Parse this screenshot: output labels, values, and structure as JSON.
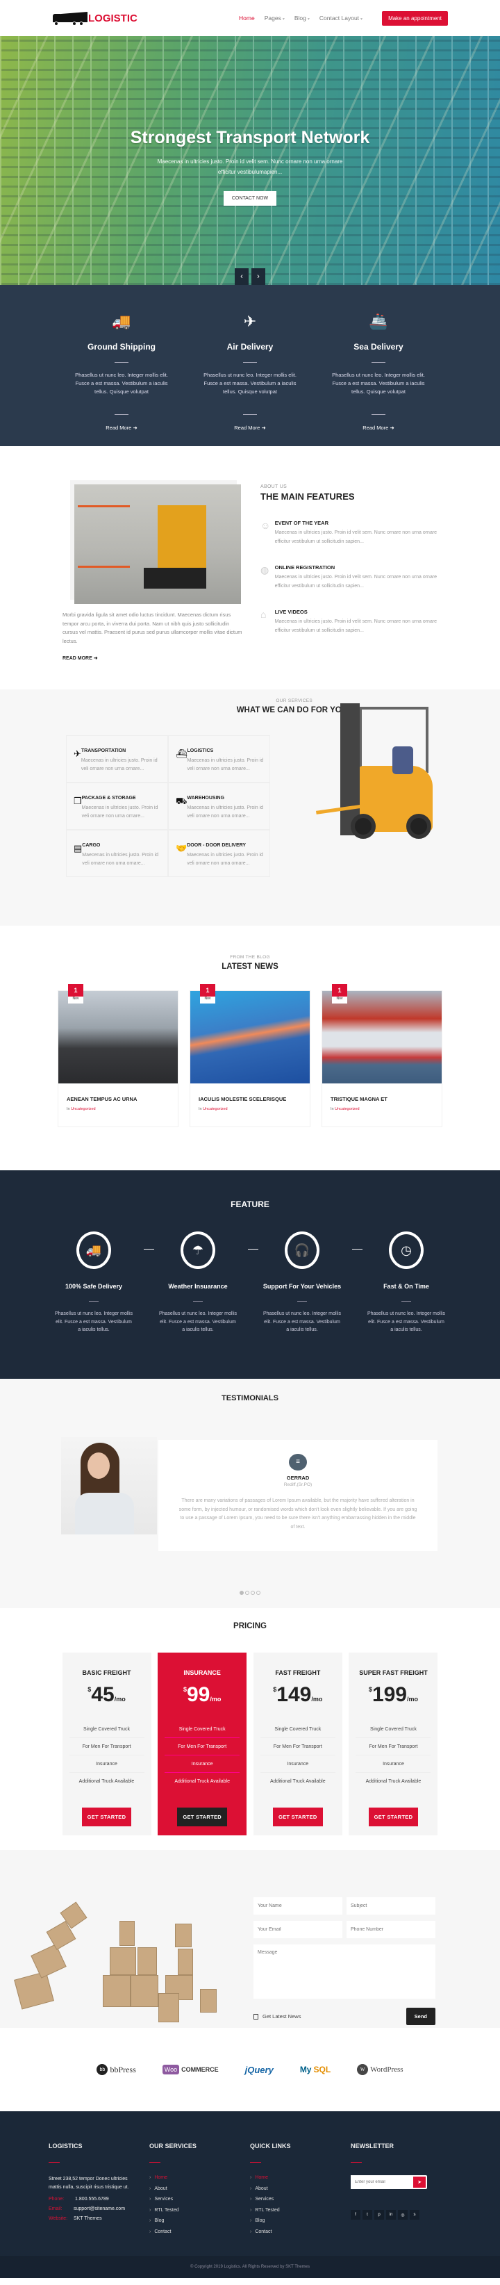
{
  "header": {
    "logo_text": "LOGISTIC",
    "nav": [
      {
        "label": "Home",
        "active": true,
        "dropdown": false
      },
      {
        "label": "Pages",
        "active": false,
        "dropdown": true
      },
      {
        "label": "Blog",
        "active": false,
        "dropdown": true
      },
      {
        "label": "Contact Layout",
        "active": false,
        "dropdown": true
      }
    ],
    "appointment_label": "Make an appointment"
  },
  "hero": {
    "title": "Strongest Transport Network",
    "subtitle": "Maecenas in ultricies justo. Proin id velit sem. Nunc ornare non urna ornare efficitur vestibulumapien...",
    "button_label": "CONTACT NOW",
    "prev_icon": "‹",
    "next_icon": "›"
  },
  "delivery": [
    {
      "icon": "truck-icon",
      "glyph": "🚚",
      "title": "Ground Shipping",
      "text": "Phasellus ut nunc leo. Integer mollis elit. Fusce a est massa. Vestibulum a iaculis tellus. Quisque volutpat",
      "link": "Read More"
    },
    {
      "icon": "plane-icon",
      "glyph": "✈",
      "title": "Air Delivery",
      "text": "Phasellus ut nunc leo. Integer mollis elit. Fusce a est massa. Vestibulum a iaculis tellus. Quisque volutpat",
      "link": "Read More"
    },
    {
      "icon": "ship-icon",
      "glyph": "🚢",
      "title": "Sea Delivery",
      "text": "Phasellus ut nunc leo. Integer mollis elit. Fusce a est massa. Vestibulum a iaculis tellus. Quisque volutpat",
      "link": "Read More"
    }
  ],
  "about": {
    "eyebrow": "ABOUT US",
    "title": "THE MAIN FEATURES",
    "text": "Morbi gravida ligula sit amet odio luctus tincidunt. Maecenas dictum risus tempor arcu porta, in viverra dui porta. Nam ut nibh quis justo sollicitudin cursus vel mattis. Praesent id purus sed purus ullamcorper mollis vitae dictum lectus.",
    "read_more": "READ MORE",
    "features": [
      {
        "icon": "worker-icon",
        "title": "EVENT OF THE YEAR",
        "text": "Maecenas in ultricies justo. Proin id velit sem. Nunc ornare non urna ornare efficitur vestibulum ut sollicitudin sapien..."
      },
      {
        "icon": "globe-icon",
        "title": "ONLINE REGISTRATION",
        "text": "Maecenas in ultricies justo. Proin id velit sem. Nunc ornare non urna ornare efficitur vestibulum ut sollicitudin sapien..."
      },
      {
        "icon": "warehouse-icon",
        "title": "LIVE VIDEOS",
        "text": "Maecenas in ultricies justo. Proin id velit sem. Nunc ornare non urna ornare efficitur vestibulum ut sollicitudin sapien..."
      }
    ]
  },
  "services": {
    "eyebrow": "OUR SERVICES",
    "title": "WHAT WE CAN DO FOR YOU",
    "items": [
      {
        "icon": "plane-icon",
        "glyph": "✈",
        "title": "TRANSPORTATION",
        "text": "Maecenas in ultricies justo. Proin id veli ornare non urna ornare..."
      },
      {
        "icon": "ship-icon",
        "glyph": "⛴",
        "title": "LOGISTICS",
        "text": "Maecenas in ultricies justo. Proin id veli ornare non urna ornare..."
      },
      {
        "icon": "boxes-icon",
        "glyph": "❒",
        "title": "PACKAGE & STORAGE",
        "text": "Maecenas in ultricies justo. Proin id veli ornare non urna ornare..."
      },
      {
        "icon": "cart-icon",
        "glyph": "⛟",
        "title": "WAREHOUSING",
        "text": "Maecenas in ultricies justo. Proin id veli ornare non urna ornare..."
      },
      {
        "icon": "box-icon",
        "glyph": "▤",
        "title": "CARGO",
        "text": "Maecenas in ultricies justo. Proin id veli ornare non urna ornare..."
      },
      {
        "icon": "handshake-icon",
        "glyph": "🤝",
        "title": "DOOR - DOOR DELIVERY",
        "text": "Maecenas in ultricies justo. Proin id veli ornare non urna ornare..."
      }
    ]
  },
  "news": {
    "eyebrow": "FROM THE BLOG",
    "title": "LATEST NEWS",
    "posts": [
      {
        "day": "1",
        "month": "Nov",
        "title": "AENEAN TEMPUS AC URNA",
        "cat_prefix": "In",
        "category": "Uncategorized",
        "img_bg": "linear-gradient(180deg,#c5ccd4 0%,#9aa3ab 40%,#3a3b3e 62%,#2a2b2e 100%)"
      },
      {
        "day": "1",
        "month": "Nov",
        "title": "IACULIS MOLESTIE SCELERISQUE",
        "cat_prefix": "In",
        "category": "Uncategorized",
        "img_bg": "linear-gradient(170deg,#2fa4df 0%,#3b7fc8 40%,#f08a5a 48%,#3068b5 58%,#1d4fa0 100%)"
      },
      {
        "day": "1",
        "month": "Nov",
        "title": "TRISTIQUE MAGNA ET",
        "cat_prefix": "In",
        "category": "Uncategorized",
        "img_bg": "linear-gradient(180deg,#aab4c0 0%,#c0392b 30%,#dfe3e8 45%,#dfe3e8 60%,#c63a3a 72%,#4b6a8a 80%,#3e5c7e 100%)"
      }
    ]
  },
  "feature": {
    "title": "FEATURE",
    "items": [
      {
        "icon": "truck-icon",
        "glyph": "🚚",
        "title": "100% Safe Delivery",
        "text": "Phasellus ut nunc leo. Integer mollis elit. Fusce a est massa. Vestibulum a iaculis tellus."
      },
      {
        "icon": "umbrella-icon",
        "glyph": "☂",
        "title": "Weather Insuarance",
        "text": "Phasellus ut nunc leo. Integer mollis elit. Fusce a est massa. Vestibulum a iaculis tellus."
      },
      {
        "icon": "headphones-icon",
        "glyph": "🎧",
        "title": "Support For Your Vehicles",
        "text": "Phasellus ut nunc leo. Integer mollis elit. Fusce a est massa. Vestibulum a iaculis tellus."
      },
      {
        "icon": "clock-icon",
        "glyph": "◷",
        "title": "Fast & On Time",
        "text": "Phasellus ut nunc leo. Integer mollis elit. Fusce a est massa. Vestibulum a iaculis tellus."
      }
    ]
  },
  "testimonials": {
    "title": "TESTIMONIALS",
    "name": "GERRAD",
    "role": "Rediff,(Sr.PO)",
    "quote": "There are many variations of passages of Lorem Ipsum available, but the majority have suffered alteration in some form, by injected humour, or randomised words which don't look even slightly believable. If you are going to use a passage of Lorem Ipsum, you need to be sure there isn't anything embarrassing hidden in the middle of text.",
    "bubble_glyph": "≡",
    "dots": 4,
    "active_dot": 0
  },
  "pricing": {
    "title": "PRICING",
    "plans": [
      {
        "name": "BASIC FREIGHT",
        "currency": "$",
        "amount": "45",
        "period": "/mo",
        "highlight": false,
        "features": [
          "Single Covered Truck",
          "For Men For Transport",
          "Insurance",
          "Additional Truck Available"
        ],
        "button": "GET STARTED"
      },
      {
        "name": "INSURANCE",
        "currency": "$",
        "amount": "99",
        "period": "/mo",
        "highlight": true,
        "features": [
          "Single Covered Truck",
          "For Men For Transport",
          "Insurance",
          "Additional Truck Available"
        ],
        "button": "GET STARTED"
      },
      {
        "name": "FAST FREIGHT",
        "currency": "$",
        "amount": "149",
        "period": "/mo",
        "highlight": false,
        "features": [
          "Single Covered Truck",
          "For Men For Transport",
          "Insurance",
          "Additional Truck Available"
        ],
        "button": "GET STARTED"
      },
      {
        "name": "SUPER FAST FREIGHT",
        "currency": "$",
        "amount": "199",
        "period": "/mo",
        "highlight": false,
        "features": [
          "Single Covered Truck",
          "For Men For Transport",
          "Insurance",
          "Additional Truck Available"
        ],
        "button": "GET STARTED"
      }
    ]
  },
  "contact": {
    "name_placeholder": "Your Name",
    "subject_placeholder": "Subject",
    "email_placeholder": "Your Email",
    "phone_placeholder": "Phone Number",
    "message_placeholder": "Message",
    "checkbox_label": "Get Latest News",
    "send_label": "Send"
  },
  "brands": [
    "bbPress",
    "WooCommerce",
    "jQuery",
    "MySQL",
    "WordPress"
  ],
  "footer": {
    "col1": {
      "title": "LOGISTICS",
      "address": "Street 238,52 tempor Donec ultricies mattis nulla, suscipit risus tristique ut.",
      "phone_label": "Phone:",
      "phone": "1.800.555.6789",
      "email_label": "Email:",
      "email": "support@sitename.com",
      "website_label": "Website:",
      "website": "SKT Themes"
    },
    "col2": {
      "title": "OUR SERVICES",
      "links": [
        "Home",
        "About",
        "Services",
        "RTL Tested",
        "Blog",
        "Contact"
      ]
    },
    "col3": {
      "title": "QUICK LINKS",
      "links": [
        "Home",
        "About",
        "Services",
        "RTL Tested",
        "Blog",
        "Contact"
      ]
    },
    "col4": {
      "title": "NEWSLETTER",
      "email_placeholder": "Enter your email",
      "social": [
        "f",
        "t",
        "p",
        "in",
        "◎",
        "s"
      ],
      "social_names": [
        "facebook-icon",
        "twitter-icon",
        "pinterest-icon",
        "linkedin-icon",
        "instagram-icon",
        "skype-icon"
      ]
    },
    "copyright": "© Copyright 2019 Logistics. All Rights Reserved by SKT Themes"
  },
  "colors": {
    "accent": "#dc1034",
    "dark_navy": "#1e2a3a",
    "slate": "#2b3a4d"
  }
}
